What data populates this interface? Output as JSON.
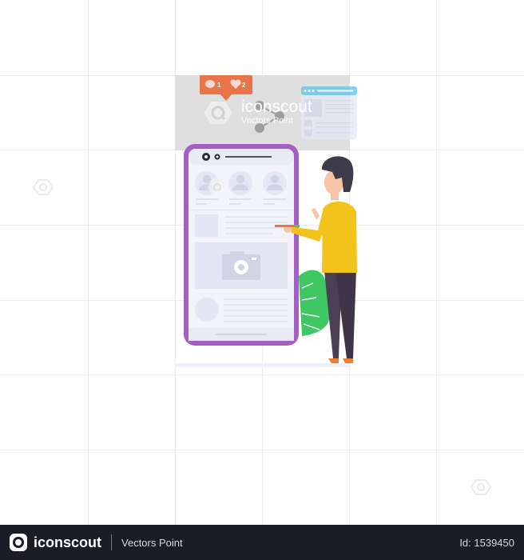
{
  "illustration": {
    "subject": "man-writing-on-social-media-phone-mockup",
    "notification_bubble": {
      "comment_count": "1",
      "like_count": "2",
      "color": "#e8744a"
    },
    "phone": {
      "frame_color": "#a35fc4",
      "screen_color": "#f3f4fb",
      "placeholder_color": "#e3e6f3"
    },
    "character": {
      "hair_color": "#3d3b4a",
      "shirt_color": "#f2c31b",
      "pants_color": "#4a3f55",
      "shoe_color": "#f07c2c",
      "skin_color": "#f7c3a6"
    },
    "plant_color": "#3fc764",
    "browser_window_accent": "#5ec3e8"
  },
  "watermark": {
    "brand": "iconscout",
    "author": "Vectors Point"
  },
  "footer": {
    "brand": "iconscout",
    "author": "Vectors Point",
    "id_label": "Id: 1539450"
  }
}
